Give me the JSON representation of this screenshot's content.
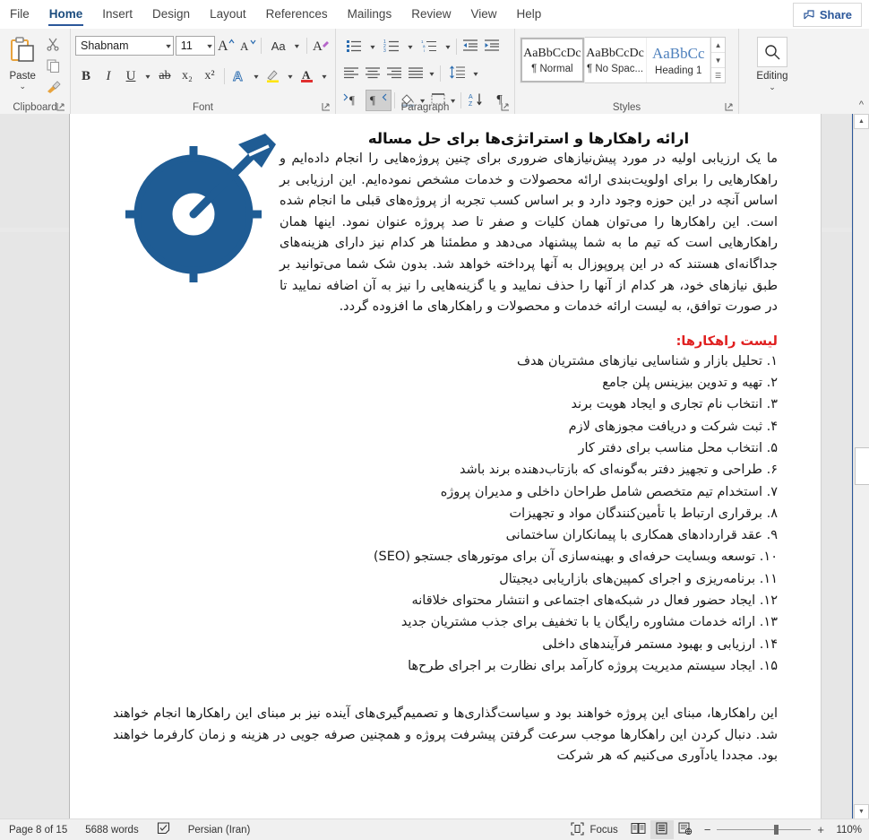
{
  "window": {
    "tabs": [
      {
        "label": "File",
        "active": false
      },
      {
        "label": "Home",
        "active": true
      },
      {
        "label": "Insert",
        "active": false
      },
      {
        "label": "Design",
        "active": false
      },
      {
        "label": "Layout",
        "active": false
      },
      {
        "label": "References",
        "active": false
      },
      {
        "label": "Mailings",
        "active": false
      },
      {
        "label": "Review",
        "active": false
      },
      {
        "label": "View",
        "active": false
      },
      {
        "label": "Help",
        "active": false
      }
    ],
    "share_label": "Share",
    "share_icon": "share-person-icon"
  },
  "ribbon": {
    "clipboard": {
      "group_label": "Clipboard",
      "paste_label": "Paste",
      "paste_caret": "⌄",
      "paste_icon": "paste-clipboard-icon",
      "cut_icon": "scissors-icon",
      "copy_icon": "copy-documents-icon",
      "format_painter_icon": "format-painter-brush-icon",
      "launcher_icon": "dialog-launcher-icon"
    },
    "font": {
      "group_label": "Font",
      "font_name": "Shabnam",
      "font_size": "11",
      "grow_font_icon": "grow-font-icon",
      "shrink_font_icon": "shrink-font-icon",
      "change_case_label": "Aa",
      "change_case_icon": "change-case-icon",
      "clear_formatting_icon": "clear-formatting-icon",
      "bold_label": "B",
      "italic_label": "I",
      "underline_label": "U",
      "strikethrough_label": "ab",
      "subscript_label": "x₂",
      "superscript_label": "x²",
      "text_effects_label": "A",
      "text_highlight_icon": "highlighter-pen-icon",
      "font_color_label": "A",
      "launcher_icon": "dialog-launcher-icon"
    },
    "paragraph": {
      "group_label": "Paragraph",
      "bullets_icon": "bullet-list-icon",
      "numbering_icon": "numbered-list-icon",
      "multilevel_icon": "multilevel-list-icon",
      "decrease_indent_icon": "decrease-indent-icon",
      "increase_indent_icon": "increase-indent-icon",
      "align_left_icon": "align-left-icon",
      "align_center_icon": "align-center-icon",
      "align_right_icon": "align-right-icon",
      "justify_icon": "justify-icon",
      "line_spacing_icon": "line-spacing-icon",
      "ltr_icon": "left-to-right-text-icon",
      "rtl_icon": "right-to-left-text-icon",
      "shading_icon": "shading-paint-icon",
      "borders_icon": "borders-icon",
      "sort_icon": "sort-az-icon",
      "show_marks_icon": "pilcrow-icon",
      "launcher_icon": "dialog-launcher-icon"
    },
    "styles": {
      "group_label": "Styles",
      "items": [
        {
          "sample": "AaBbCcDc",
          "name": "¶ Normal",
          "selected": true
        },
        {
          "sample": "AaBbCcDc",
          "name": "¶ No Spac...",
          "selected": false
        },
        {
          "sample": "AaBbCс",
          "name": "Heading 1",
          "selected": false
        }
      ],
      "scroll_up_icon": "chevron-up-icon",
      "scroll_down_icon": "chevron-down-icon",
      "more_icon": "styles-more-icon",
      "launcher_icon": "dialog-launcher-icon"
    },
    "editing": {
      "group_label": "Editing",
      "find_icon": "magnifier-icon",
      "caret": "⌄"
    },
    "collapse_icon": "collapse-ribbon-chevron-icon"
  },
  "document": {
    "title": "ارائه راهکارها و استراتژی‌ها برای حل مساله",
    "intro_paragraph": "ما یک ارزیابی اولیه در مورد پیش‌نیازهای ضروری برای چنین پروژه‌هایی را انجام داده‌ایم و راهکارهایی را برای اولویت‌بندی ارائه محصولات و خدمات مشخص نموده‌ایم. این ارزیابی بر اساس آنچه در این حوزه وجود دارد و بر اساس کسب تجربه از پروژه‌های قبلی ما انجام شده است. این راهکارها را می‌توان همان کلیات و صفر تا صد پروژه عنوان نمود. اینها همان راهکارهایی است که تیم ما به شما پیشنهاد می‌دهد و مطمئنا هر کدام نیز دارای هزینه‌های جداگانه‌ای هستند که در این پروپوزال به آنها پرداخته خواهد شد. بدون شک شما می‌توانید بر طبق نیازهای خود، هر کدام از آنها را حذف نمایید و یا گزینه‌هایی را نیز به آن اضافه نمایید تا در صورت توافق، به لیست ارائه خدمات و محصولات و راهکارهای ما افزوده گردد.",
    "list_heading": "لیست راهکارها:",
    "solutions": [
      "۱. تحلیل بازار و شناسایی نیازهای مشتریان هدف",
      "۲. تهیه و تدوین بیزینس پلن جامع",
      "۳. انتخاب نام تجاری و ایجاد هویت برند",
      "۴. ثبت شرکت و دریافت مجوزهای لازم",
      "۵. انتخاب محل مناسب برای دفتر کار",
      "۶. طراحی و تجهیز دفتر به‌گونه‌ای که بازتاب‌دهنده برند باشد",
      "۷. استخدام تیم متخصص شامل طراحان داخلی و مدیران پروژه",
      "۸. برقراری ارتباط با تأمین‌کنندگان مواد و تجهیزات",
      "۹. عقد قراردادهای همکاری با پیمانکاران ساختمانی",
      "۱۰. توسعه وبسایت حرفه‌ای و بهینه‌سازی آن برای موتورهای جستجو (SEO)",
      "۱۱. برنامه‌ریزی و اجرای کمپین‌های بازاریابی دیجیتال",
      "۱۲. ایجاد حضور فعال در شبکه‌های اجتماعی و انتشار محتوای خلاقانه",
      "۱۳. ارائه خدمات مشاوره رایگان یا با تخفیف برای جذب مشتریان جدید",
      "۱۴. ارزیابی و بهبود مستمر فرآیندهای داخلی",
      "۱۵. ایجاد سیستم مدیریت پروژه کارآمد برای نظارت بر اجرای طرح‌ها"
    ],
    "closing_paragraph": "این راهکارها، مبنای این پروژه خواهند بود و سیاست‌گذاری‌ها و تصمیم‌گیری‌های آینده نیز بر مبنای این راهکارها انجام خواهند شد. دنبال کردن این راهکارها موجب سرعت گرفتن پیشرفت پروژه و همچنین صرفه جویی در هزینه و زمان کارفرما خواهند بود. مجددا یادآوری می‌کنیم که هر شرکت",
    "target_icon": "target-with-dart-icon",
    "target_color": "#1f5c94"
  },
  "statusbar": {
    "page_label": "Page 8 of 15",
    "word_count": "5688 words",
    "proofing_icon": "proofing-errors-icon",
    "language": "Persian (Iran)",
    "focus_label": "Focus",
    "focus_icon": "focus-mode-icon",
    "read_mode_icon": "read-mode-icon",
    "print_layout_icon": "print-layout-icon",
    "web_layout_icon": "web-layout-icon",
    "zoom_out_label": "−",
    "zoom_in_label": "+",
    "zoom_percent": "110%"
  }
}
